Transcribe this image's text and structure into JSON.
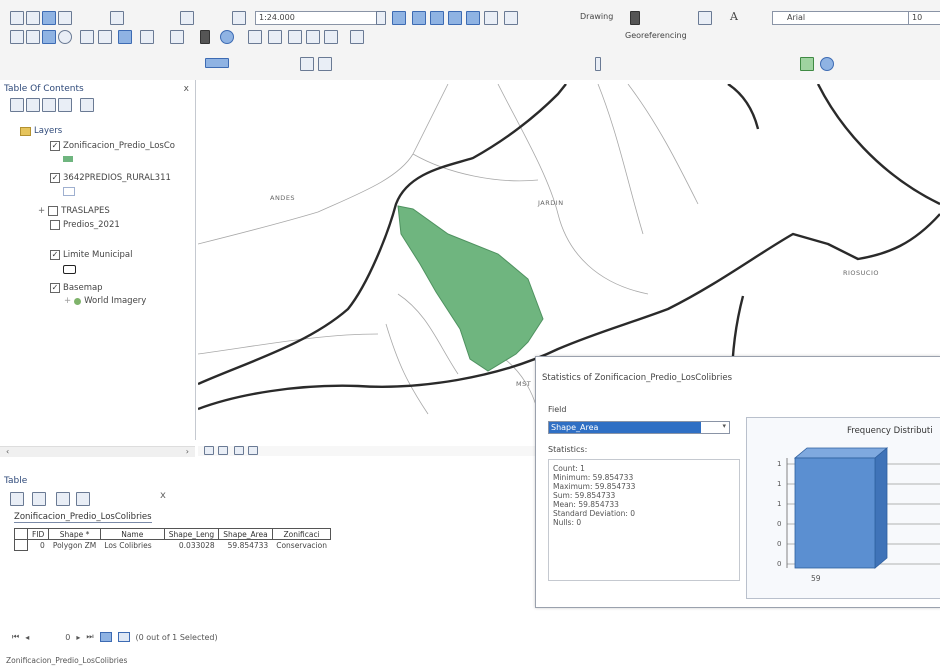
{
  "toolbar": {
    "scale": "1:24.000",
    "drawing_label": "Drawing",
    "text_tool_label": "A",
    "georef_label": "Georeferencing",
    "font_name": "Arial",
    "font_size": "10"
  },
  "toc": {
    "title": "Table Of Contents",
    "close": "x",
    "layers_label": "Layers",
    "items": [
      {
        "label": "Zonificacion_Predio_LosCo",
        "checked": true
      },
      {
        "label": "3642PREDIOS_RURAL311",
        "checked": true
      },
      {
        "label": "TRASLAPES",
        "checked": false
      },
      {
        "label": "Predios_2021",
        "checked": false
      },
      {
        "label": "Limite Municipal",
        "checked": true
      },
      {
        "label": "Basemap",
        "checked": true
      },
      {
        "label": "World Imagery",
        "checked": false
      }
    ],
    "swatch_color": "#6fb57f"
  },
  "map": {
    "labels": {
      "andes": "ANDES",
      "jardin": "JARDIN",
      "riosucio": "RIOSUCIO",
      "mst": "MST"
    },
    "polygon_color": "#6fb57f"
  },
  "table": {
    "title": "Table",
    "close": "x",
    "layer_tab": "Zonificacion_Predio_LosColibries",
    "columns": [
      "FID",
      "Shape *",
      "Name",
      "Shape_Leng",
      "Shape_Area",
      "Zonificaci"
    ],
    "rows": [
      [
        "0",
        "Polygon ZM",
        "Los Colibries",
        "0.033028",
        "59.854733",
        "Conservacion"
      ]
    ],
    "record_index": "0",
    "selection_status": "(0 out of 1 Selected)",
    "footer_tab": "Zonificacion_Predio_LosColibries"
  },
  "stats": {
    "title": "Statistics of Zonificacion_Predio_LosColibries",
    "field_label": "Field",
    "field_value": "Shape_Area",
    "statistics_label": "Statistics:",
    "count": "Count:   1",
    "minimum": "Minimum: 59.854733",
    "maximum": "Maximum: 59.854733",
    "sum": "Sum:     59.854733",
    "mean": "Mean:    59.854733",
    "std": "Standard Deviation: 0",
    "nulls": "Nulls:   0",
    "chart_title": "Frequency Distributi",
    "chart_x_label": "59",
    "chart_y_ticks": [
      "1",
      "1",
      "1",
      "0",
      "0",
      "0"
    ],
    "bar_color": "#5b8fd1"
  }
}
